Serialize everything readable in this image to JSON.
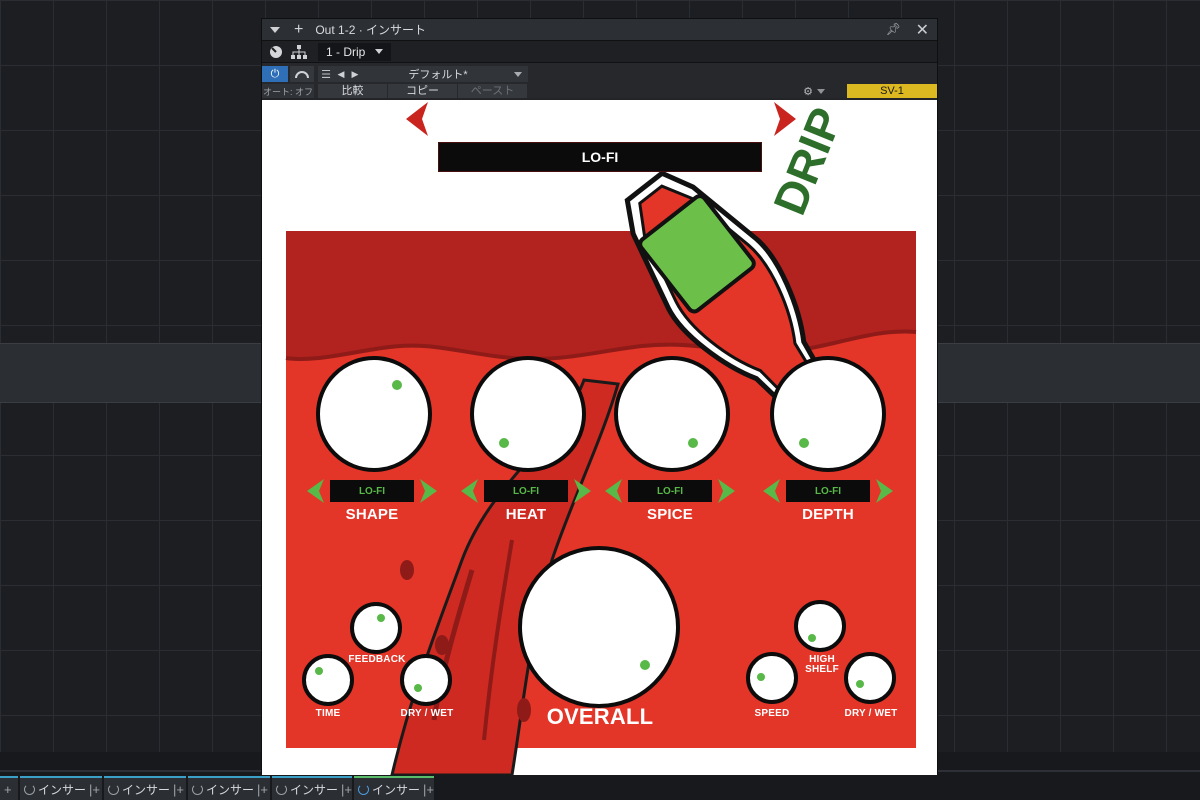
{
  "window": {
    "title": "Out 1-2 · インサート",
    "plugin_slot": "1 - Drip",
    "auto_label": "オート: オフ",
    "preset_name": "デフォルト*",
    "compare_label": "比較",
    "copy_label": "コピー",
    "paste_label": "ペースト",
    "device_label": "SV-1"
  },
  "plugin": {
    "preset_display": "LO-FI",
    "bottle_label": "DRIP",
    "knobs": [
      {
        "label": "SHAPE",
        "mode": "LO-FI"
      },
      {
        "label": "HEAT",
        "mode": "LO-FI"
      },
      {
        "label": "SPICE",
        "mode": "LO-FI"
      },
      {
        "label": "DEPTH",
        "mode": "LO-FI"
      }
    ],
    "delay_knobs": {
      "feedback": "FEEDBACK",
      "time": "TIME",
      "drywet": "DRY / WET"
    },
    "overall": "OVERALL",
    "filter_knobs": {
      "high_shelf_1": "HIGH",
      "high_shelf_2": "SHELF",
      "speed": "SPEED",
      "drywet": "DRY / WET"
    }
  },
  "bottom_slots": [
    {
      "label": "インサー"
    },
    {
      "label": "インサー"
    },
    {
      "label": "インサー"
    },
    {
      "label": "インサー"
    },
    {
      "label": "インサー"
    }
  ],
  "colors": {
    "accent_red": "#e33528",
    "dark_red": "#b2221f",
    "knob_dot": "#58b848",
    "bottle_green": "#6cc04a",
    "device_yellow": "#dcb821"
  }
}
